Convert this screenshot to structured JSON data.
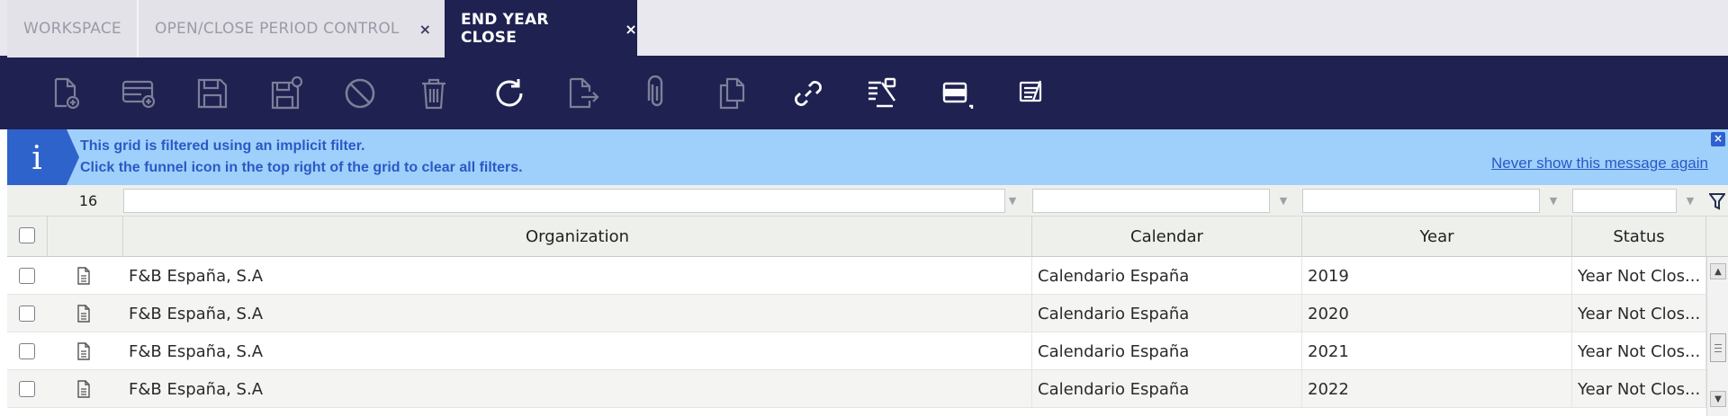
{
  "tabs": [
    {
      "label": "WORKSPACE",
      "closable": false
    },
    {
      "label": "OPEN/CLOSE PERIOD CONTROL",
      "closable": true
    },
    {
      "label": "END YEAR CLOSE",
      "closable": true,
      "active": true
    }
  ],
  "tab_close_glyph": "×",
  "toolbar": {
    "icons": [
      "new-document-icon",
      "new-row-icon",
      "save-icon",
      "save-close-icon",
      "cancel-icon",
      "delete-icon",
      "refresh-icon",
      "export-icon",
      "attachment-icon",
      "clone-icon",
      "link-icon",
      "tree-icon",
      "grid-view-icon",
      "notes-icon"
    ]
  },
  "banner": {
    "icon_glyph": "i",
    "line1": "This grid is filtered using an implicit filter.",
    "line2": "Click the funnel icon in the top right of the grid to clear all filters.",
    "dismiss_link": "Never show this message again",
    "close_glyph": "×"
  },
  "grid": {
    "record_count": "16",
    "columns": [
      "Organization",
      "Calendar",
      "Year",
      "Status"
    ],
    "rows": [
      {
        "organization": "F&B España, S.A",
        "calendar": "Calendario España",
        "year": "2019",
        "status": "Year Not Clos..."
      },
      {
        "organization": "F&B España, S.A",
        "calendar": "Calendario España",
        "year": "2020",
        "status": "Year Not Clos..."
      },
      {
        "organization": "F&B España, S.A",
        "calendar": "Calendario España",
        "year": "2021",
        "status": "Year Not Clos..."
      },
      {
        "organization": "F&B España, S.A",
        "calendar": "Calendario España",
        "year": "2022",
        "status": "Year Not Clos..."
      }
    ]
  },
  "colors": {
    "navy": "#1f2151",
    "banner_bg": "#9fd0fb",
    "banner_text": "#2b59c4",
    "tab_bg": "#e2e2e8"
  }
}
